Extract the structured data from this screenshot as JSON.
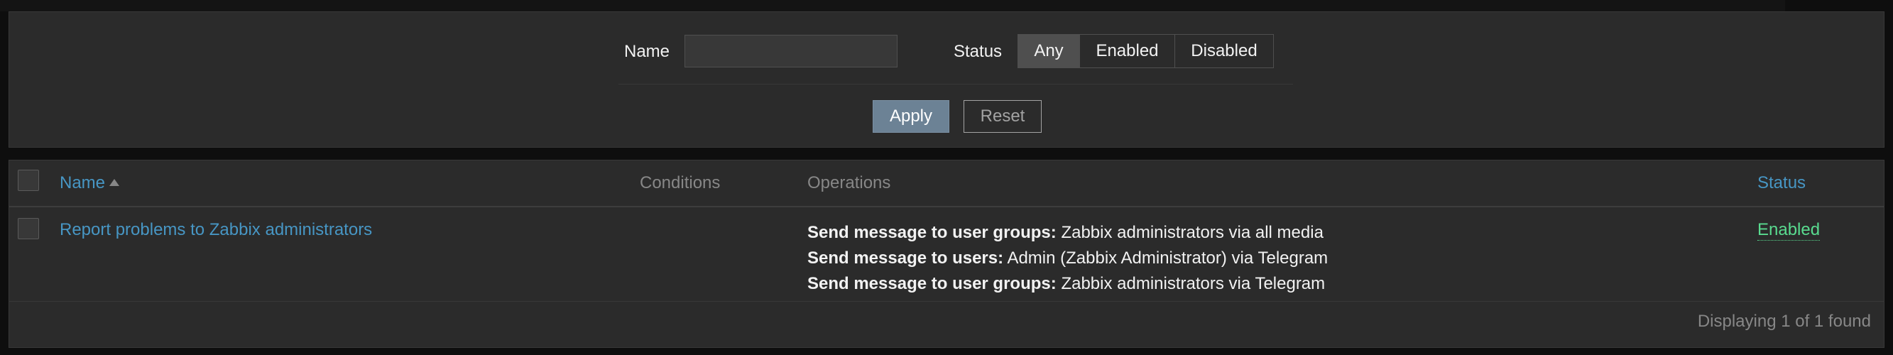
{
  "filter": {
    "name_label": "Name",
    "name_value": "",
    "status_label": "Status",
    "status_options": [
      "Any",
      "Enabled",
      "Disabled"
    ],
    "status_selected": "Any",
    "apply_label": "Apply",
    "reset_label": "Reset"
  },
  "table": {
    "columns": {
      "name": "Name",
      "conditions": "Conditions",
      "operations": "Operations",
      "status": "Status"
    },
    "rows": [
      {
        "name": "Report problems to Zabbix administrators",
        "conditions": "",
        "operations": [
          {
            "label": "Send message to user groups:",
            "detail": "Zabbix administrators via all media"
          },
          {
            "label": "Send message to users:",
            "detail": "Admin (Zabbix Administrator) via Telegram"
          },
          {
            "label": "Send message to user groups:",
            "detail": "Zabbix administrators via Telegram"
          }
        ],
        "status": "Enabled"
      }
    ],
    "footer": "Displaying 1 of 1 found"
  },
  "colors": {
    "background": "#0e0e0e",
    "panel": "#2b2b2b",
    "link": "#4796c4",
    "status_enabled": "#59db8f",
    "apply_button": "#6c8295"
  },
  "icons": {
    "sort": "sort-ascending-icon"
  }
}
